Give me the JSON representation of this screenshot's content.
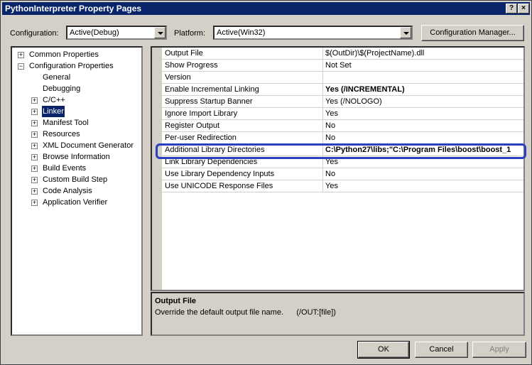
{
  "window": {
    "title": "PythonInterpreter Property Pages",
    "help_glyph": "?",
    "close_glyph": "×"
  },
  "top": {
    "configuration_label": "Configuration:",
    "configuration_value": "Active(Debug)",
    "platform_label": "Platform:",
    "platform_value": "Active(Win32)",
    "config_manager_button": "Configuration Manager..."
  },
  "tree": {
    "items": [
      {
        "label": "Common Properties",
        "expander": "+"
      },
      {
        "label": "Configuration Properties",
        "expander": "−"
      },
      {
        "label": "General"
      },
      {
        "label": "Debugging"
      },
      {
        "label": "C/C++",
        "expander": "+"
      },
      {
        "label": "Linker",
        "expander": "+",
        "selected": true
      },
      {
        "label": "Manifest Tool",
        "expander": "+"
      },
      {
        "label": "Resources",
        "expander": "+"
      },
      {
        "label": "XML Document Generator",
        "expander": "+"
      },
      {
        "label": "Browse Information",
        "expander": "+"
      },
      {
        "label": "Build Events",
        "expander": "+"
      },
      {
        "label": "Custom Build Step",
        "expander": "+"
      },
      {
        "label": "Code Analysis",
        "expander": "+"
      },
      {
        "label": "Application Verifier",
        "expander": "+"
      }
    ]
  },
  "grid": {
    "rows": [
      {
        "name": "Output File",
        "value": "$(OutDir)\\$(ProjectName).dll"
      },
      {
        "name": "Show Progress",
        "value": "Not Set"
      },
      {
        "name": "Version",
        "value": ""
      },
      {
        "name": "Enable Incremental Linking",
        "value": "Yes (/INCREMENTAL)",
        "bold": true
      },
      {
        "name": "Suppress Startup Banner",
        "value": "Yes (/NOLOGO)"
      },
      {
        "name": "Ignore Import Library",
        "value": "Yes"
      },
      {
        "name": "Register Output",
        "value": "No"
      },
      {
        "name": "Per-user Redirection",
        "value": "No"
      },
      {
        "name": "Additional Library Directories",
        "value": "C:\\Python27\\libs;\"C:\\Program Files\\boost\\boost_1",
        "bold": true
      },
      {
        "name": "Link Library Dependencies",
        "value": "Yes"
      },
      {
        "name": "Use Library Dependency Inputs",
        "value": "No"
      },
      {
        "name": "Use UNICODE Response Files",
        "value": "Yes"
      }
    ]
  },
  "description": {
    "title": "Output File",
    "text": "Override the default output file name.      (/OUT:[file])"
  },
  "buttons": {
    "ok": "OK",
    "cancel": "Cancel",
    "apply": "Apply"
  },
  "colors": {
    "highlight_outline": "#2b3fbf",
    "title_bar": "#0a246a",
    "selected_item": "#0a246a"
  }
}
